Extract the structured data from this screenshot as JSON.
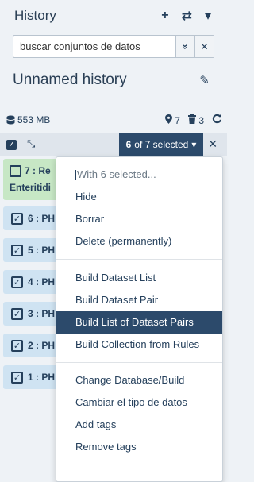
{
  "header": {
    "title": "History",
    "plus_icon": "+",
    "switch_icon": "⇄",
    "caret_icon": "▾"
  },
  "search": {
    "value": "buscar conjuntos de datos",
    "advanced_icon": "»",
    "clear_icon": "✕"
  },
  "history": {
    "name": "Unnamed history",
    "edit_icon": "✎"
  },
  "stats": {
    "size": "553 MB",
    "pinned_count": "7",
    "deleted_count": "3"
  },
  "selection": {
    "count": "6",
    "label": "of 7 selected",
    "caret": "▾",
    "close_icon": "✕"
  },
  "items": [
    {
      "id": "7",
      "label": "7 : Re",
      "sublabel": "Enteritidi",
      "state": "ok",
      "color": "#c7e7c5"
    },
    {
      "id": "6",
      "label": "6 : PH",
      "check": "✓"
    },
    {
      "id": "5",
      "label": "5 : PH",
      "check": "✓"
    },
    {
      "id": "4",
      "label": "4 : PH",
      "check": "✓"
    },
    {
      "id": "3",
      "label": "3 : PH",
      "check": "✓"
    },
    {
      "id": "2",
      "label": "2 : PH",
      "check": "✓"
    },
    {
      "id": "1",
      "label": "1 : PH",
      "check": "✓"
    }
  ],
  "menu": {
    "header": "With 6 selected...",
    "group1": [
      "Hide",
      "Borrar",
      "Delete (permanently)"
    ],
    "group2": [
      "Build Dataset List",
      "Build Dataset Pair",
      "Build List of Dataset Pairs",
      "Build Collection from Rules"
    ],
    "group3": [
      "Change Database/Build",
      "Cambiar el tipo de datos",
      "Add tags",
      "Remove tags"
    ],
    "active": "Build List of Dataset Pairs"
  },
  "colors": {
    "accent": "#2c4a6b",
    "item_bg": "#cfe3f2",
    "ok_bg": "#c7e7c5"
  }
}
